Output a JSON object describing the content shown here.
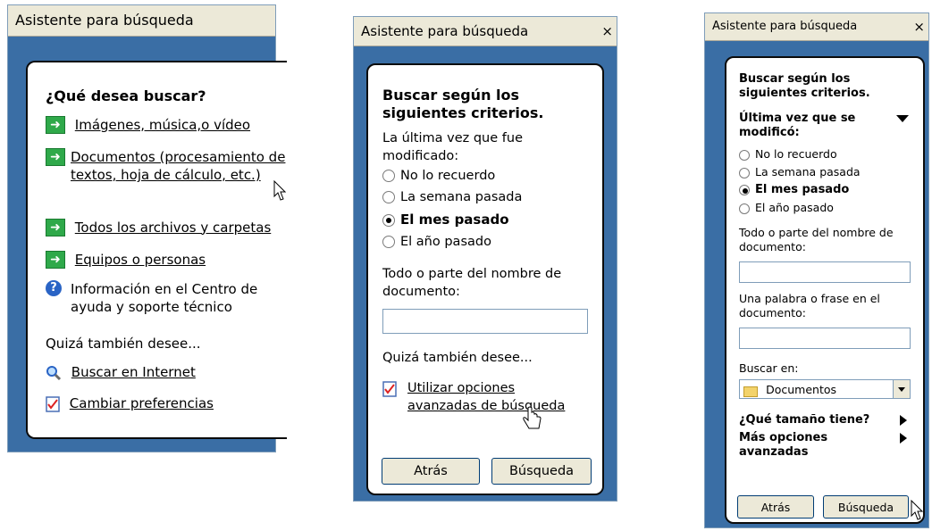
{
  "panels": [
    {
      "title": "Asistente para búsqueda",
      "heading": "¿Qué desea buscar?",
      "items": [
        {
          "label": "Imágenes, música,o vídeo",
          "icon": "green-arrow-icon"
        },
        {
          "label": "Documentos (procesamiento de textos, hoja de cálculo, etc.)",
          "icon": "green-arrow-icon"
        },
        {
          "label": "Todos los archivos y carpetas",
          "icon": "green-arrow-icon"
        },
        {
          "label": "Equipos o personas",
          "icon": "green-arrow-icon"
        },
        {
          "label": "Información en el Centro de ayuda y soporte técnico",
          "icon": "help-icon"
        }
      ],
      "also_label": "Quizá también desee...",
      "also_items": [
        {
          "label": "Buscar en Internet",
          "icon": "search-icon"
        },
        {
          "label": "Cambiar preferencias",
          "icon": "preferences-icon"
        }
      ]
    },
    {
      "title": "Asistente para búsqueda",
      "close": "×",
      "heading": "Buscar según los siguientes criterios.",
      "last_modified_label": "La última vez que fue modificado:",
      "options": [
        "No lo recuerdo",
        "La semana pasada",
        "El mes pasado",
        "El año pasado"
      ],
      "selected_option": "El mes pasado",
      "name_label": "Todo o parte del nombre de documento:",
      "name_value": "",
      "also_label": "Quizá también desee...",
      "advanced_link": "Utilizar opciones avanzadas de búsqueda",
      "back_button": "Atrás",
      "search_button": "Búsqueda"
    },
    {
      "title": "Asistente para búsqueda",
      "close": "×",
      "heading": "Buscar según los siguientes criterios.",
      "last_modified_label": "Última vez que se modificó:",
      "options": [
        "No lo recuerdo",
        "La semana pasada",
        "El mes pasado",
        "El año pasado"
      ],
      "selected_option": "El mes pasado",
      "name_label": "Todo o parte del nombre de documento:",
      "name_value": "",
      "phrase_label": "Una palabra o frase en el documento:",
      "phrase_value": "",
      "search_in_label": "Buscar en:",
      "search_in_value": "Documentos",
      "size_label": "¿Qué tamaño tiene?",
      "more_label": "Más opciones avanzadas",
      "back_button": "Atrás",
      "search_button": "Búsqueda"
    }
  ]
}
